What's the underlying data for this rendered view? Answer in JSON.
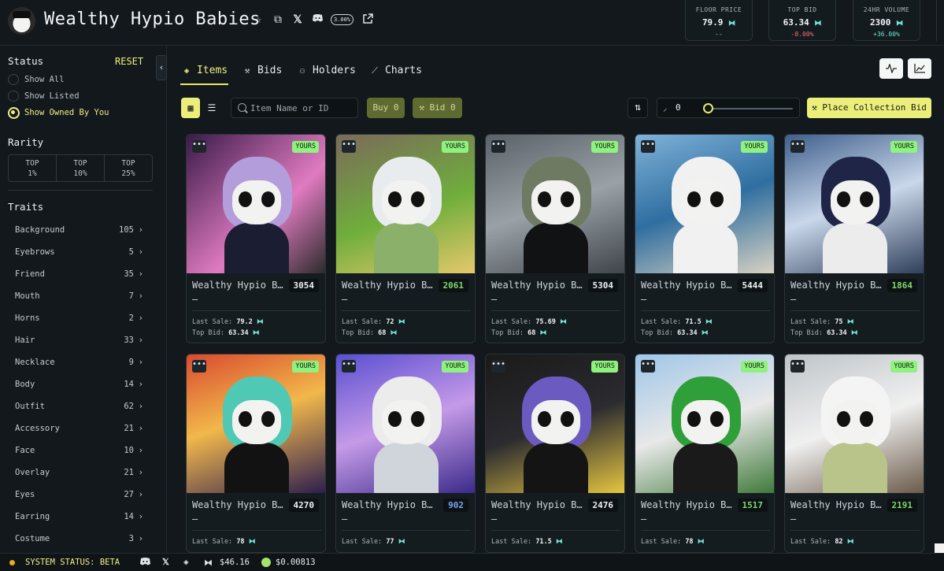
{
  "header": {
    "title": "Wealthy Hypio Babies",
    "royalty": "3.00%",
    "stats": [
      {
        "label": "FLOOR PRICE",
        "value": "79.9",
        "change": "--",
        "change_color": "#6ee7d3"
      },
      {
        "label": "TOP BID",
        "value": "63.34",
        "change": "-8.00%",
        "change_color": "#ff6b6b"
      },
      {
        "label": "24HR VOLUME",
        "value": "2300",
        "change": "+36.00%",
        "change_color": "#6ee7d3"
      }
    ]
  },
  "sidebar": {
    "status_heading": "Status",
    "reset_label": "RESET",
    "status_options": [
      "Show All",
      "Show Listed",
      "Show Owned By You"
    ],
    "rarity_heading": "Rarity",
    "rarity_options": [
      {
        "line1": "TOP",
        "line2": "1%"
      },
      {
        "line1": "TOP",
        "line2": "10%"
      },
      {
        "line1": "TOP",
        "line2": "25%"
      }
    ],
    "traits_heading": "Traits",
    "traits": [
      {
        "name": "Background",
        "count": "105"
      },
      {
        "name": "Eyebrows",
        "count": "5"
      },
      {
        "name": "Friend",
        "count": "35"
      },
      {
        "name": "Mouth",
        "count": "7"
      },
      {
        "name": "Horns",
        "count": "2"
      },
      {
        "name": "Hair",
        "count": "33"
      },
      {
        "name": "Necklace",
        "count": "9"
      },
      {
        "name": "Body",
        "count": "14"
      },
      {
        "name": "Outfit",
        "count": "62"
      },
      {
        "name": "Accessory",
        "count": "21"
      },
      {
        "name": "Face",
        "count": "10"
      },
      {
        "name": "Overlay",
        "count": "21"
      },
      {
        "name": "Eyes",
        "count": "27"
      },
      {
        "name": "Earring",
        "count": "14"
      },
      {
        "name": "Costume",
        "count": "3"
      }
    ]
  },
  "tabs": [
    "Items",
    "Bids",
    "Holders",
    "Charts"
  ],
  "toolbar": {
    "search_placeholder": "Item Name or ID",
    "buy_label": "Buy 0",
    "bid_label": "Bid 0",
    "sweep_count": "0",
    "collection_bid_label": "Place Collection Bid"
  },
  "cards": [
    {
      "name": "Wealthy Hypio B…",
      "id": "3054",
      "id_color": "white",
      "dash": "–",
      "last_sale": "79.2",
      "top_bid": "63.34",
      "badge": "YOURS"
    },
    {
      "name": "Wealthy Hypio B…",
      "id": "2061",
      "id_color": "green",
      "dash": "–",
      "last_sale": "72",
      "top_bid": "68",
      "badge": "YOURS"
    },
    {
      "name": "Wealthy Hypio B…",
      "id": "5304",
      "id_color": "white",
      "dash": "–",
      "last_sale": "75.69",
      "top_bid": "68",
      "badge": "YOURS"
    },
    {
      "name": "Wealthy Hypio B…",
      "id": "5444",
      "id_color": "white",
      "dash": "–",
      "last_sale": "71.5",
      "top_bid": "63.34",
      "badge": "YOURS"
    },
    {
      "name": "Wealthy Hypio B…",
      "id": "1864",
      "id_color": "green",
      "dash": "–",
      "last_sale": "75",
      "top_bid": "63.34",
      "badge": "YOURS"
    },
    {
      "name": "Wealthy Hypio B…",
      "id": "4270",
      "id_color": "white",
      "dash": "–",
      "last_sale": "78",
      "top_bid": "",
      "badge": "YOURS"
    },
    {
      "name": "Wealthy Hypio B…",
      "id": "902",
      "id_color": "blue",
      "dash": "–",
      "last_sale": "77",
      "top_bid": "",
      "badge": "YOURS"
    },
    {
      "name": "Wealthy Hypio B…",
      "id": "2476",
      "id_color": "white",
      "dash": "–",
      "last_sale": "71.5",
      "top_bid": "",
      "badge": "YOURS"
    },
    {
      "name": "Wealthy Hypio B…",
      "id": "1517",
      "id_color": "green",
      "dash": "–",
      "last_sale": "78",
      "top_bid": "",
      "badge": "YOURS"
    },
    {
      "name": "Wealthy Hypio B…",
      "id": "2191",
      "id_color": "green",
      "dash": "–",
      "last_sale": "82",
      "top_bid": "",
      "badge": "YOURS"
    }
  ],
  "labels": {
    "last_sale": "Last Sale:",
    "top_bid": "Top Bid:"
  },
  "footer": {
    "system_status": "SYSTEM STATUS: BETA",
    "hype_price": "$46.16",
    "token_price": "$0.00813"
  },
  "colors": {
    "accent": "#ecee7a",
    "yours": "#8ef27e",
    "hype": "#6ee7d3",
    "background": "#12181c"
  }
}
